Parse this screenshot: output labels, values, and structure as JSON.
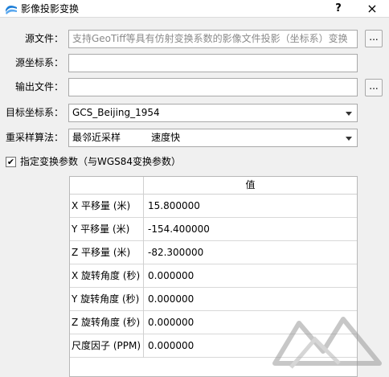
{
  "window": {
    "title": "影像投影变换",
    "help_label": "?",
    "close_label": "×"
  },
  "form": {
    "source_file": {
      "label": "源文件：",
      "placeholder": "支持GeoTiff等具有仿射变换系数的影像文件投影（坐标系）变换",
      "browse_label": "..."
    },
    "source_crs": {
      "label": "源坐标系：",
      "value": ""
    },
    "output_file": {
      "label": "输出文件：",
      "value": "",
      "browse_label": "..."
    },
    "target_crs": {
      "label": "目标坐标系：",
      "value": "GCS_Beijing_1954"
    },
    "resample": {
      "label": "重采样算法：",
      "value": "最邻近采样          速度快"
    }
  },
  "transform": {
    "checkbox_checked": true,
    "checkbox_mark": "✔",
    "checkbox_label": "指定变换参数（与WGS84变换参数）",
    "column_header": "值",
    "rows": [
      {
        "name": "X 平移量 (米)",
        "value": "15.800000"
      },
      {
        "name": "Y 平移量 (米)",
        "value": "-154.400000"
      },
      {
        "name": "Z 平移量 (米)",
        "value": "-82.300000"
      },
      {
        "name": "X 旋转角度 (秒)",
        "value": "0.000000"
      },
      {
        "name": "Y 旋转角度 (秒)",
        "value": "0.000000"
      },
      {
        "name": "Z 旋转角度 (秒)",
        "value": "0.000000"
      },
      {
        "name": "尺度因子 (PPM)",
        "value": "0.000000"
      }
    ]
  },
  "colors": {
    "accent": "#1e7fd8",
    "border": "#a9a9a9",
    "window_bg": "#f0f0f0"
  },
  "icons": {
    "app": "wave-logo-icon",
    "dropdown": "chevron-down-icon",
    "check": "check-icon"
  }
}
